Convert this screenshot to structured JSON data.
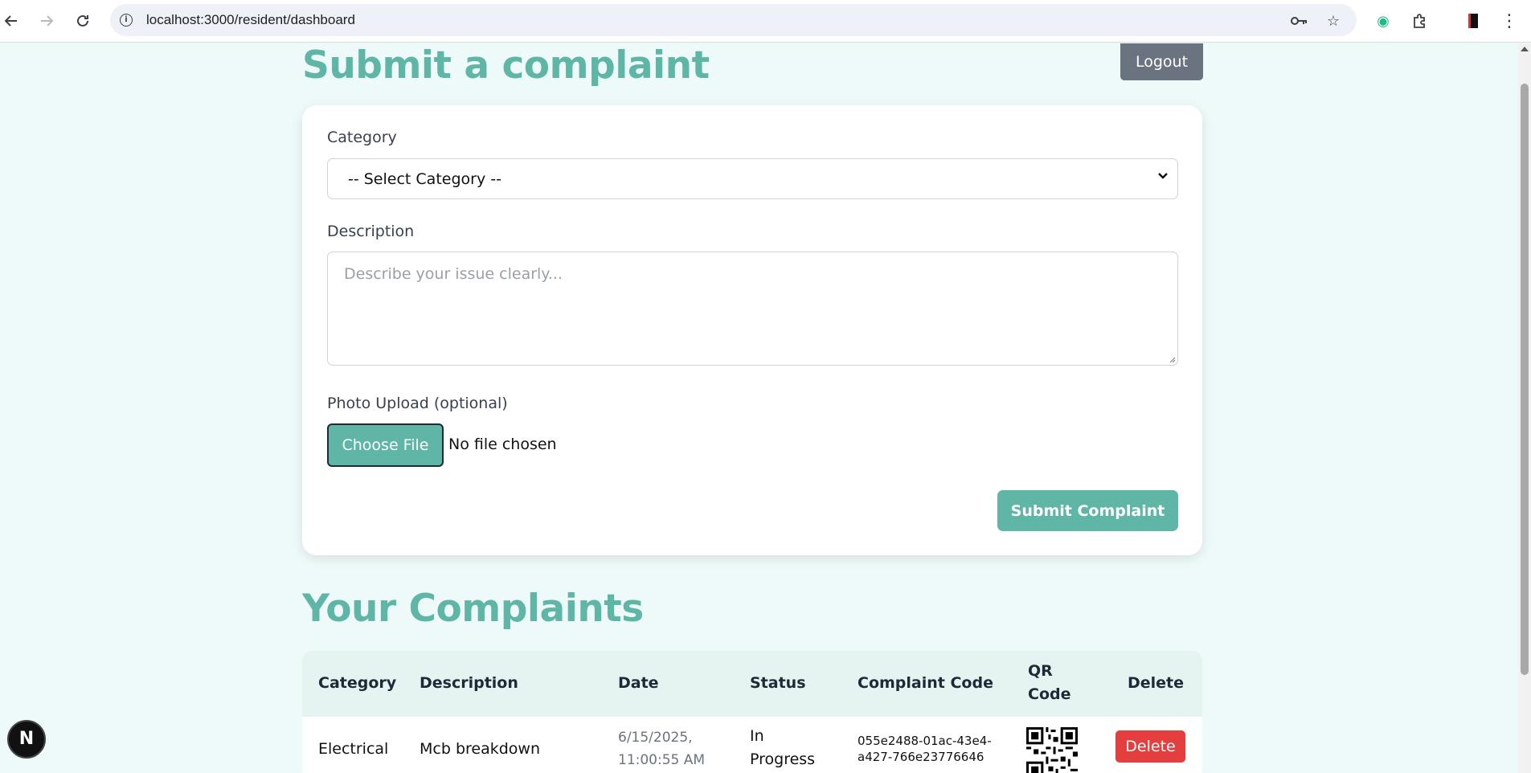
{
  "browser": {
    "url": "localhost:3000/resident/dashboard"
  },
  "header": {
    "title": "Submit a complaint",
    "logout_label": "Logout"
  },
  "form": {
    "category_label": "Category",
    "category_value": "-- Select Category --",
    "description_label": "Description",
    "description_placeholder": "Describe your issue clearly...",
    "photo_label": "Photo Upload (optional)",
    "choose_file_label": "Choose File",
    "file_status": "No file chosen",
    "submit_label": "Submit Complaint"
  },
  "complaints": {
    "title": "Your Complaints",
    "columns": {
      "category": "Category",
      "description": "Description",
      "date": "Date",
      "status": "Status",
      "code": "Complaint Code",
      "qr_line1": "QR",
      "qr_line2": "Code",
      "delete": "Delete"
    },
    "rows": [
      {
        "category": "Electrical",
        "description": "Mcb breakdown",
        "date_line1": "6/15/2025,",
        "date_line2": "11:00:55 AM",
        "status_line1": "In",
        "status_line2": "Progress",
        "code_line1": "055e2488-01ac-43e4-",
        "code_line2": "a427-766e23776646",
        "delete_label": "Delete"
      }
    ]
  },
  "colors": {
    "accent": "#5fb5a6",
    "danger": "#e53e3e",
    "logout": "#6b7280",
    "background": "#eefaf9"
  },
  "devtools_badge": "N"
}
